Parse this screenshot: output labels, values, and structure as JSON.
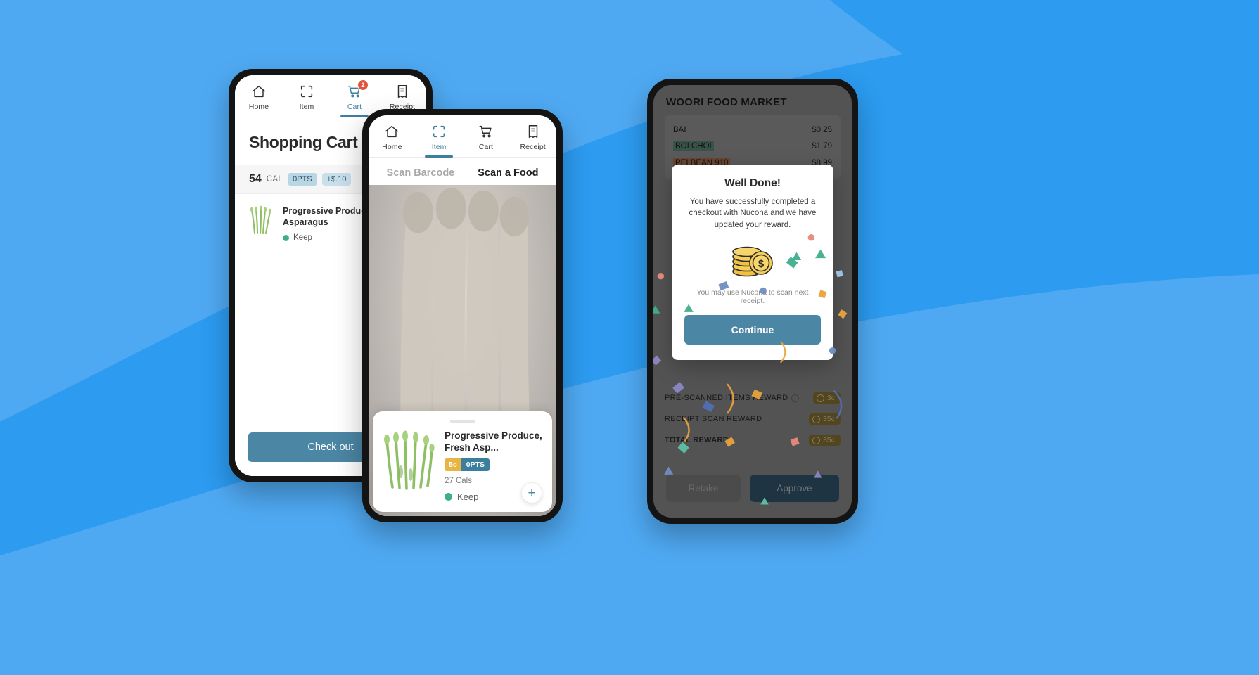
{
  "background": {
    "light_blue": "#4FA9F2",
    "mid_blue": "#2C9BF0",
    "deep_blue": "#1E8EEB"
  },
  "phone_cart": {
    "tabs": [
      {
        "label": "Home",
        "icon": "home-icon",
        "active": false,
        "badge": ""
      },
      {
        "label": "Item",
        "icon": "scan-icon",
        "active": false,
        "badge": ""
      },
      {
        "label": "Cart",
        "icon": "cart-icon",
        "active": true,
        "badge": "2"
      },
      {
        "label": "Receipt",
        "icon": "receipt-icon",
        "active": false,
        "badge": ""
      }
    ],
    "title": "Shopping Cart",
    "summary": {
      "calories": "54",
      "cal_unit": "CAL",
      "points_chip": "0PTS",
      "money_chip": "+$.10"
    },
    "items": [
      {
        "name": "Progressive Produce, Fresh Asparagus",
        "status": "Keep",
        "status_color": "#3FAE8E",
        "thumb": "asparagus-icon"
      }
    ],
    "checkout_label": "Check out"
  },
  "phone_scan": {
    "tabs": [
      {
        "label": "Home",
        "icon": "home-icon",
        "active": false
      },
      {
        "label": "Item",
        "icon": "scan-icon",
        "active": true
      },
      {
        "label": "Cart",
        "icon": "cart-icon",
        "active": false
      },
      {
        "label": "Receipt",
        "icon": "receipt-icon",
        "active": false
      }
    ],
    "segments": [
      {
        "label": "Scan Barcode",
        "active": false
      },
      {
        "label": "Scan a Food",
        "active": true
      }
    ],
    "food_card": {
      "name": "Progressive Produce, Fresh Asp...",
      "money_pill": "5c",
      "points_pill": "0PTS",
      "calories": "27 Cals",
      "status": "Keep",
      "status_color": "#3FAE8E",
      "add_label": "+"
    }
  },
  "phone_receipt": {
    "store": "WOORI FOOD MARKET",
    "lines": [
      {
        "name": "BAI",
        "price": "$0.25",
        "highlight": "none"
      },
      {
        "name": "BOI CHOI",
        "price": "$1.79",
        "highlight": "green"
      },
      {
        "name": "PEI BEAN 910",
        "price": "$8.99",
        "highlight": "orange"
      }
    ],
    "rewards": [
      {
        "label": "PRE-SCANNED ITEMS REWARD",
        "value": "3c",
        "has_info": true
      },
      {
        "label": "RECEIPT SCAN REWARD",
        "value": "35c",
        "has_info": false
      },
      {
        "label": "TOTAL REWARD",
        "value": "35c",
        "has_info": false,
        "bold": true
      }
    ],
    "retake_label": "Retake",
    "approve_label": "Approve",
    "modal": {
      "title": "Well Done!",
      "body": "You have successfully completed a checkout with Nucona and we have updated your reward.",
      "icon": "coins-icon",
      "note": "You may use Nucona to scan next receipt.",
      "continue_label": "Continue"
    }
  }
}
